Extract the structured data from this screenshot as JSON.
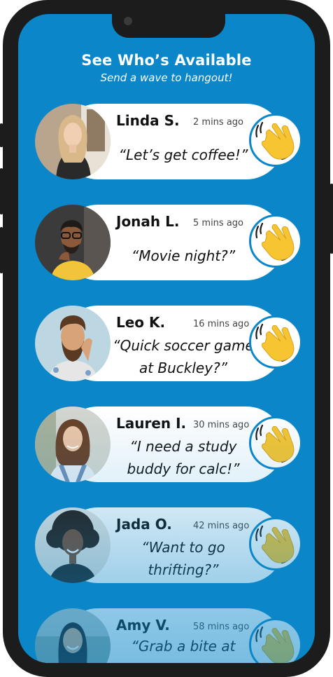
{
  "header": {
    "title": "See Who’s Available",
    "subtitle": "Send a wave to hangout!"
  },
  "colors": {
    "background": "#0a86c9",
    "card": "#ffffff",
    "wave": "#f7c531",
    "frame": "#1c1c1c"
  },
  "people": [
    {
      "name": "Linda S.",
      "time": "2 mins ago",
      "message": "“Let’s get coffee!”",
      "icon": "waving-hand-icon"
    },
    {
      "name": "Jonah L.",
      "time": "5 mins ago",
      "message": "“Movie night?”",
      "icon": "waving-hand-icon"
    },
    {
      "name": "Leo K.",
      "time": "16 mins ago",
      "message": "“Quick soccer game at Buckley?”",
      "icon": "waving-hand-icon"
    },
    {
      "name": "Lauren I.",
      "time": "30 mins ago",
      "message": "“I need a study buddy for calc!”",
      "icon": "waving-hand-icon"
    },
    {
      "name": "Jada O.",
      "time": "42 mins ago",
      "message": "“Want to go thrifting?”",
      "icon": "waving-hand-icon"
    },
    {
      "name": "Amy V.",
      "time": "58 mins ago",
      "message": "“Grab a bite at",
      "icon": "waving-hand-icon"
    }
  ]
}
